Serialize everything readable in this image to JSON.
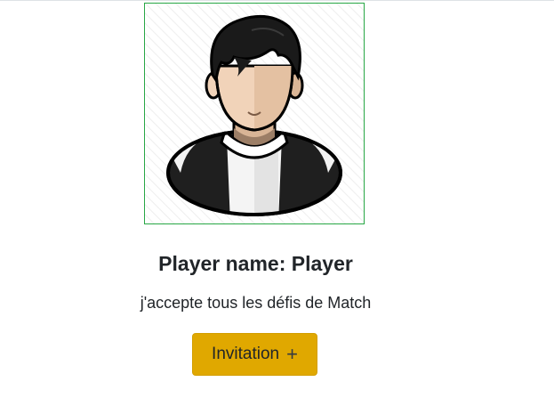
{
  "player": {
    "title": "Player name: Player",
    "description": "j'accepte tous les défis de Match",
    "avatar_icon": "male-avatar-icon"
  },
  "actions": {
    "invite_label": "Invitation",
    "invite_icon": "plus-icon",
    "invite_icon_glyph": "+"
  },
  "colors": {
    "avatar_border": "#28a745",
    "button_bg": "#e0a800"
  }
}
